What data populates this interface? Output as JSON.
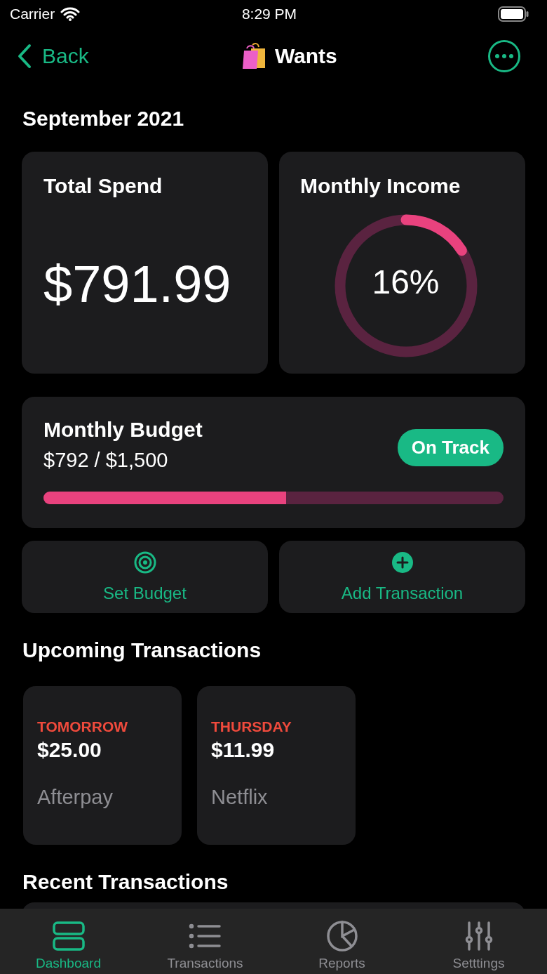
{
  "status_bar": {
    "carrier": "Carrier",
    "time": "8:29 PM"
  },
  "nav": {
    "back": "Back",
    "title": "Wants"
  },
  "month": "September 2021",
  "total_spend": {
    "title": "Total Spend",
    "amount": "$791.99"
  },
  "monthly_income": {
    "title": "Monthly Income",
    "percent": "16%",
    "level": 0.16
  },
  "budget": {
    "title": "Monthly Budget",
    "amount": "$792 / $1,500",
    "status": "On Track",
    "level": 0.528
  },
  "actions": [
    {
      "kind": "target",
      "label": "Set Budget"
    },
    {
      "kind": "add",
      "label": "Add Transaction"
    }
  ],
  "upcoming": {
    "title": "Upcoming Transactions",
    "items": [
      {
        "when": "TOMORROW",
        "amount": "$25.00",
        "payee": "Afterpay"
      },
      {
        "when": "THURSDAY",
        "amount": "$11.99",
        "payee": "Netflix"
      }
    ]
  },
  "recent": {
    "title": "Recent Transactions"
  },
  "tabs": [
    {
      "kind": "dashboard",
      "label": "Dashboard",
      "selected": true
    },
    {
      "kind": "list",
      "label": "Transactions",
      "selected": false
    },
    {
      "kind": "reports",
      "label": "Reports",
      "selected": false
    },
    {
      "kind": "sliders",
      "label": "Setttings",
      "selected": false
    }
  ]
}
